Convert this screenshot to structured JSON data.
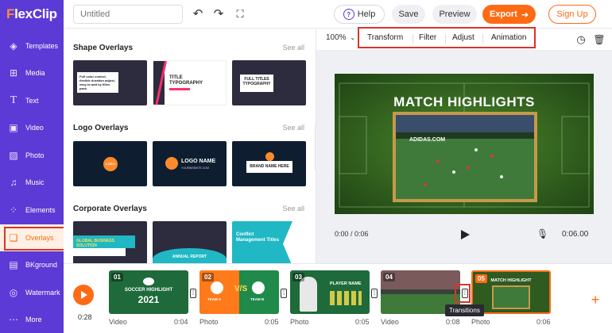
{
  "app": {
    "logo_f": "F",
    "logo_rest": "lexClip"
  },
  "header": {
    "title_placeholder": "Untitled",
    "help_label": "Help",
    "save_label": "Save",
    "preview_label": "Preview",
    "export_label": "Export",
    "signup_label": "Sign Up"
  },
  "sidebar": {
    "items": [
      {
        "label": "Templates",
        "icon": "layers-icon"
      },
      {
        "label": "Media",
        "icon": "media-icon"
      },
      {
        "label": "Text",
        "icon": "text-icon"
      },
      {
        "label": "Video",
        "icon": "video-icon"
      },
      {
        "label": "Photo",
        "icon": "photo-icon"
      },
      {
        "label": "Music",
        "icon": "music-icon"
      },
      {
        "label": "Elements",
        "icon": "elements-icon"
      },
      {
        "label": "Overlays",
        "icon": "overlays-icon",
        "active": true
      },
      {
        "label": "BKground",
        "icon": "background-icon"
      },
      {
        "label": "Watermark",
        "icon": "watermark-icon"
      },
      {
        "label": "More",
        "icon": "more-icon"
      }
    ]
  },
  "panel": {
    "sections": [
      {
        "title": "Shape Overlays",
        "see_all": "See all",
        "thumbs": [
          {
            "text": "Full color control, flexible duration adjust, easy to add by titles pack"
          },
          {
            "text": "TITLE TYPOGRAPHY"
          },
          {
            "text": "FULL TITLES TYPOGRAPHY"
          }
        ]
      },
      {
        "title": "Logo Overlays",
        "see_all": "See all",
        "thumbs": [
          {
            "text": "LOGO"
          },
          {
            "text": "LOGO NAME",
            "sub": "YOURWEBSITE.COM"
          },
          {
            "text": "BRAND NAME HERE"
          }
        ]
      },
      {
        "title": "Corporate Overlays",
        "see_all": "See all",
        "thumbs": [
          {
            "text": "GLOBAL BUSINESS SOLUTION"
          },
          {
            "text": "ANNUAL REPORT"
          },
          {
            "text": "Conflict Management Titles"
          }
        ]
      }
    ]
  },
  "toolbar": {
    "zoom": "100%",
    "items": [
      "Transform",
      "Filter",
      "Adjust",
      "Animation"
    ]
  },
  "preview": {
    "title": "MATCH HIGHLIGHTS",
    "ad_text": "ADIDAS.COM",
    "current_time": "0:00 / 0:06",
    "total_time": "0:06.00"
  },
  "timeline": {
    "playhead_time": "0:28",
    "tooltip": "Transitions",
    "clips": [
      {
        "num": "01",
        "type": "Video",
        "duration": "0:04",
        "caption": "SOCCER HIGHLIGHT",
        "year": "2021"
      },
      {
        "num": "02",
        "type": "Photo",
        "duration": "0:05",
        "team_a": "TEAM A",
        "team_b": "TEAM B"
      },
      {
        "num": "03",
        "type": "Photo",
        "duration": "0:05",
        "caption": "PLAYER NAME"
      },
      {
        "num": "04",
        "type": "Video",
        "duration": "0:08"
      },
      {
        "num": "05",
        "type": "Photo",
        "duration": "0:06",
        "caption": "MATCH HIGHLIGHT"
      }
    ]
  },
  "colors": {
    "brand": "#5b3ad6",
    "accent": "#ff6a14",
    "highlight": "#d9342b"
  }
}
